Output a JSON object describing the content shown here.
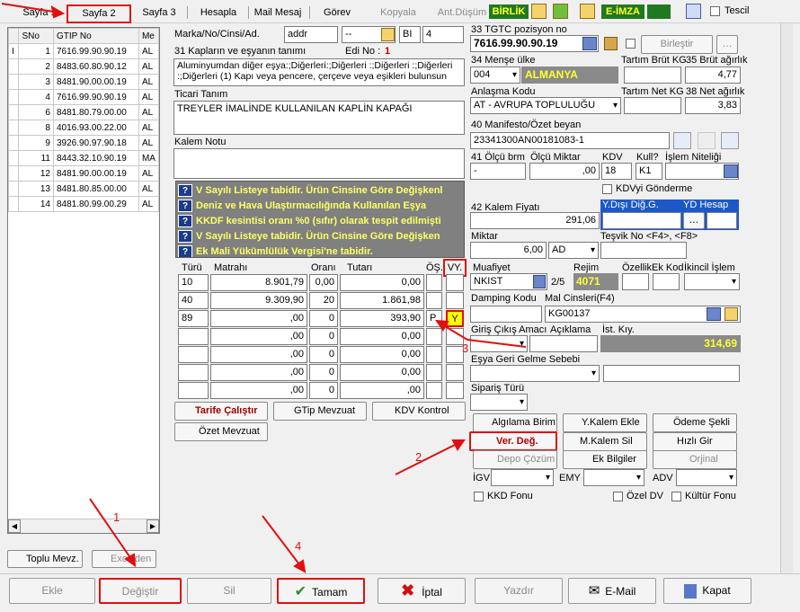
{
  "tabs": {
    "sayfa1": "Sayfa 1",
    "sayfa2": "Sayfa 2",
    "sayfa3": "Sayfa 3",
    "hesapla": "Hesapla",
    "mailmesaj": "Mail Mesaj",
    "gorev": "Görev",
    "kopyala": "Kopyala",
    "antdusum": "Ant.Düşüm",
    "birlik": "BİRLİK",
    "eimza": "E-İMZA",
    "tescil": "Tescil"
  },
  "grid": {
    "headers": [
      "SNo",
      "GTIP No",
      "Me"
    ],
    "rows": [
      {
        "mark": "I",
        "sno": "1",
        "gtip": "7616.99.90.90.19",
        "me": "AL"
      },
      {
        "mark": "",
        "sno": "2",
        "gtip": "8483.60.80.90.12",
        "me": "AL"
      },
      {
        "mark": "",
        "sno": "3",
        "gtip": "8481.90.00.00.19",
        "me": "AL"
      },
      {
        "mark": "",
        "sno": "4",
        "gtip": "7616.99.90.90.19",
        "me": "AL"
      },
      {
        "mark": "",
        "sno": "6",
        "gtip": "8481.80.79.00.00",
        "me": "AL"
      },
      {
        "mark": "",
        "sno": "8",
        "gtip": "4016.93.00.22.00",
        "me": "AL"
      },
      {
        "mark": "",
        "sno": "9",
        "gtip": "3926.90.97.90.18",
        "me": "AL"
      },
      {
        "mark": "",
        "sno": "11",
        "gtip": "8443.32.10.90.19",
        "me": "MA"
      },
      {
        "mark": "",
        "sno": "12",
        "gtip": "8481.90.00.00.19",
        "me": "AL"
      },
      {
        "mark": "",
        "sno": "13",
        "gtip": "8481.80.85.00.00",
        "me": "AL"
      },
      {
        "mark": "",
        "sno": "14",
        "gtip": "8481.80.99.00.29",
        "me": "AL"
      }
    ],
    "toplu": "Toplu Mevz.",
    "excelden": "Excelden"
  },
  "mid": {
    "marka_label": "Marka/No/Cinsi/Ad.",
    "addr": "addr",
    "dash": "--",
    "bi": "BI",
    "bi_val": "4",
    "kaplar_label": "31 Kapların ve eşyanın tanımı",
    "edi_label": "Edi No :",
    "edi_val": "1",
    "desc": "Aluminyumdan diğer eşya:;Diğerleri:;Diğerleri :;Diğerleri :;Diğerleri :;Diğerleri (1) Kapı veya pencere, çerçeve veya eşikleri bulunsun",
    "ticari_label": "Ticari Tanım",
    "ticari_val": "TREYLER İMALİNDE KULLANILAN KAPLİN KAPAĞI",
    "kalem_label": "Kalem Notu",
    "notes": [
      "V Sayılı Listeye tabidir. Ürün Cinsine Göre Değişkenl",
      "Deniz ve Hava Ulaştırmacılığında Kullanılan Eşya",
      "KKDF kesintisi oranı %0 (sıfır) olarak tespit edilmişti",
      "V Sayılı Listeye tabidir. Ürün Cinsine Göre Değişken",
      "Ek Mali Yükümlülük Vergisi'ne tabidir."
    ],
    "tax_headers": [
      "Türü",
      "Matrahı",
      "Oranı",
      "Tutarı",
      "ÖŞ.",
      "VY."
    ],
    "tax_rows": [
      [
        "10",
        "8.901,79",
        "0,00",
        "0,00",
        "",
        ""
      ],
      [
        "40",
        "9.309,90",
        "20",
        "1.861,98",
        "",
        ""
      ],
      [
        "89",
        ",00",
        "0",
        "393,90",
        "P",
        "Y"
      ],
      [
        "",
        ",00",
        "0",
        "0,00",
        "",
        ""
      ],
      [
        "",
        ",00",
        "0",
        "0,00",
        "",
        ""
      ],
      [
        "",
        ",00",
        "0",
        "0,00",
        "",
        ""
      ],
      [
        "",
        ",00",
        "0",
        ",00",
        "",
        ""
      ]
    ],
    "tarife": "Tarife Çalıştır",
    "gtip_mevzuat": "GTip Mevzuat",
    "kdv_kontrol": "KDV Kontrol",
    "ozet": "Özet Mevzuat"
  },
  "right": {
    "tgtc_label": "33 TGTC pozisyon no",
    "tgtc_val": "7616.99.90.90.19",
    "birlestir": "Birleştir",
    "mense_label": "34 Menşe ülke",
    "mense_code": "004",
    "mense_name": "ALMANYA",
    "tartim_brut_label": "Tartım Brüt KG",
    "brut_label": "35 Brüt ağırlık",
    "brut_val": "4,77",
    "anlasma_label": "Anlaşma Kodu",
    "anlasma_val": "AT    - AVRUPA TOPLULUĞU",
    "tartim_net_label": "Tartım Net KG",
    "net_label": "38 Net ağırlık",
    "net_val": "3,83",
    "manifesto_label": "40 Manifesto/Özet beyan",
    "manifesto_val": "23341300AN00181083-1",
    "olcu_label": "41 Ölçü brm",
    "olcu_val": "-",
    "olcu_miktar_label": "Ölçü Miktar",
    "olcu_miktar_val": ",00",
    "kdv_label": "KDV",
    "kdv_val": "18",
    "kull_label": "Kull?",
    "kull_val": "K1",
    "islem_label": "İşlem Niteliği",
    "kdv_gonderme": "KDVyi Gönderme",
    "kalem_fiyati_label": "42 Kalem Fiyatı",
    "kalem_fiyati_val": "291,06",
    "ydisi_label": "Y.Dışı Diğ.G.",
    "yd_hesap_label": "YD Hesap",
    "miktar_label": "Miktar",
    "miktar_val": "6,00",
    "miktar_unit": "AD",
    "tesvik_label": "Teşvik No <F4>, <F8>",
    "muafiyet_label": "Muafiyet",
    "muafiyet_val": "NKIST",
    "muafiyet_num": "2/5",
    "rejim_label": "Rejim",
    "rejim_val": "4071",
    "ozellik_label": "Özellik",
    "ekkod_label": "Ek Kod",
    "ikincil_label": "İkincil İşlem",
    "damping_label": "Damping Kodu",
    "mal_cinsleri_label": "Mal Cinsleri(F4)",
    "mal_cinsleri_val": "KG00137",
    "giris_label": "Giriş Çıkış Amacı",
    "aciklama_label": "Açıklama",
    "ist_kiy_label": "İst. Kıy.",
    "ist_kiy_val": "314,69",
    "esya_geri_label": "Eşya Geri Gelme Sebebi",
    "siparis_label": "Sipariş Türü",
    "algilama": "Algılama Birim",
    "ykalem": "Y.Kalem Ekle",
    "odeme": "Ödeme Şekli",
    "ver_deg": "Ver. Değ.",
    "mkalem": "M.Kalem Sil",
    "hizli": "Hızlı Gir",
    "depo": "Depo Çözüm",
    "ek_bilgiler": "Ek Bilgiler",
    "orjinal": "Orjinal",
    "igv": "İGV",
    "emy": "EMY",
    "adv": "ADV",
    "kkd": "KKD Fonu",
    "ozel_dv": "Özel DV",
    "kultur": "Kültür Fonu"
  },
  "bottom": {
    "ekle": "Ekle",
    "degistir": "Değiştir",
    "sil": "Sil",
    "tamam": "Tamam",
    "iptal": "İptal",
    "yazdir": "Yazdır",
    "email": "E-Mail",
    "kapat": "Kapat"
  },
  "annotations": {
    "n1": "1",
    "n2": "2",
    "n3": "3",
    "n4": "4"
  },
  "colors": {
    "accent_red": "#e01010",
    "notes_bg": "#808080",
    "notes_text": "#ffff66",
    "birlik_bg": "#1f7a1f",
    "mense_bg": "#8a8a8a"
  }
}
